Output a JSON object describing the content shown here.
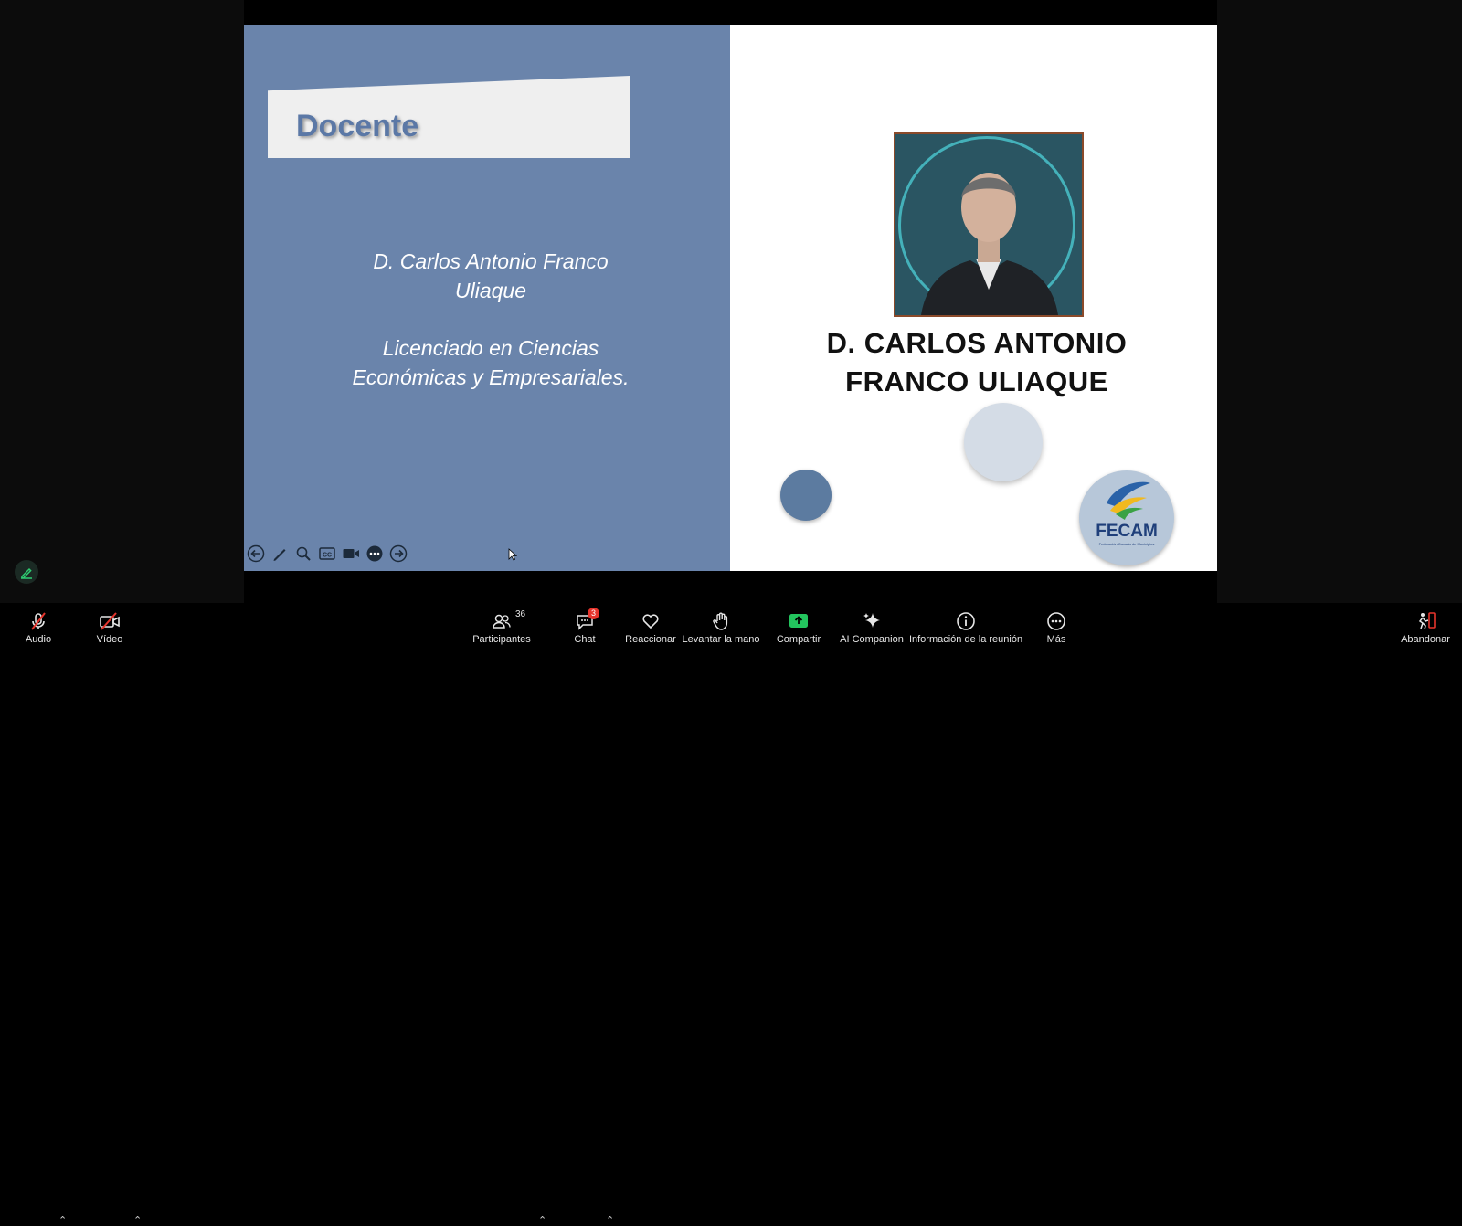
{
  "slide": {
    "banner_title": "Docente",
    "left_name_line1": "D. Carlos Antonio Franco",
    "left_name_line2": "Uliaque",
    "left_degree_line1": "Licenciado en Ciencias",
    "left_degree_line2": "Económicas y Empresariales.",
    "right_heading_line1": "D. CARLOS ANTONIO",
    "right_heading_line2": "FRANCO ULIAQUE",
    "logo_text": "FECAM",
    "logo_subtext": "Federación Canaria de Municipios"
  },
  "slide_controls": [
    "previous-icon",
    "pen-icon",
    "zoom-icon",
    "captions-icon",
    "video-icon",
    "more-icon",
    "next-icon"
  ],
  "toolbar": {
    "audio_label": "Audio",
    "video_label": "Vídeo",
    "participants_label": "Participantes",
    "participants_count": "36",
    "chat_label": "Chat",
    "chat_badge": "3",
    "react_label": "Reaccionar",
    "raise_hand_label": "Levantar la mano",
    "share_label": "Compartir",
    "ai_label": "AI Companion",
    "info_label": "Información de la reunión",
    "more_label": "Más",
    "leave_label": "Abandonar"
  },
  "colors": {
    "slide_left_bg": "#6a84ab",
    "share_accent": "#23c55e",
    "leave_accent": "#e5342c",
    "annotation_accent": "#2ecc71"
  }
}
